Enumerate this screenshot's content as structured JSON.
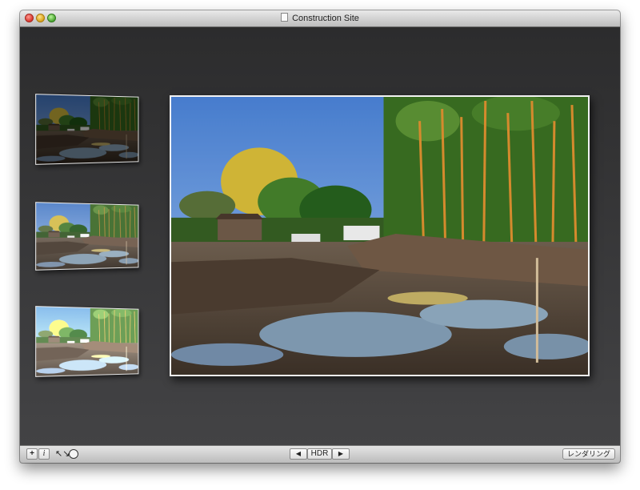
{
  "window": {
    "title": "Construction Site"
  },
  "thumbnails": [
    {
      "exposure": "dark"
    },
    {
      "exposure": "normal"
    },
    {
      "exposure": "bright"
    }
  ],
  "toolbar": {
    "add_label": "+",
    "info_label": "i",
    "fit_icon": "↖↘",
    "prev_arrow": "◀",
    "mode_label": "HDR",
    "next_arrow": "▶",
    "render_label": "レンダリング"
  },
  "colors": {
    "content_background": "#3a3a3c",
    "photo_border": "#f2f2f2",
    "sky": "#5f88c7"
  }
}
